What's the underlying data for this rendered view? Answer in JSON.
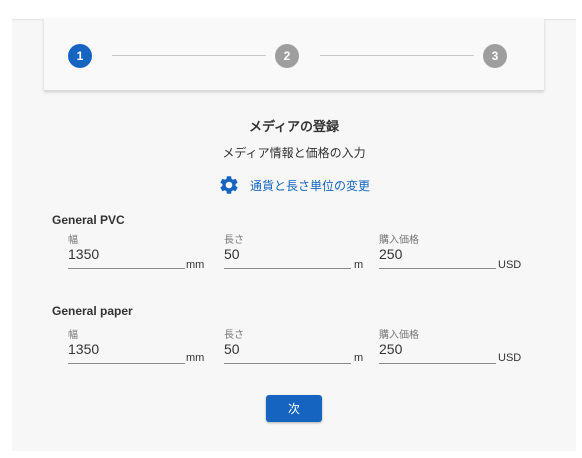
{
  "stepper": {
    "steps": [
      "1",
      "2",
      "3"
    ]
  },
  "header": {
    "title": "メディアの登録",
    "subtitle": "メディア情報と価格の入力"
  },
  "unit_link": {
    "label": "通貨と長さ単位の変更",
    "icon": "gear-icon"
  },
  "groups": [
    {
      "name": "General PVC",
      "fields": [
        {
          "label": "幅",
          "value": "1350",
          "unit": "mm"
        },
        {
          "label": "長さ",
          "value": "50",
          "unit": "m"
        },
        {
          "label": "購入価格",
          "value": "250",
          "unit": "USD"
        }
      ]
    },
    {
      "name": "General paper",
      "fields": [
        {
          "label": "幅",
          "value": "1350",
          "unit": "mm"
        },
        {
          "label": "長さ",
          "value": "50",
          "unit": "m"
        },
        {
          "label": "購入価格",
          "value": "250",
          "unit": "USD"
        }
      ]
    }
  ],
  "footer": {
    "next_label": "次"
  },
  "colors": {
    "accent": "#1565c0",
    "inactive_step": "#9e9e9e",
    "panel_bg": "#f7f7f7"
  }
}
